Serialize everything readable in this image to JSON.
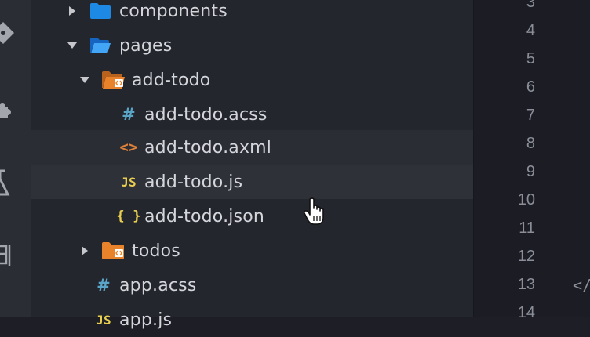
{
  "explorer": {
    "items": [
      {
        "label": "components",
        "icon": "folder-blue-icon"
      },
      {
        "label": "pages",
        "icon": "folder-open-blue-icon"
      },
      {
        "label": "add-todo",
        "icon": "folder-open-orange-icon"
      },
      {
        "label": "add-todo.acss",
        "icon": "hash-icon",
        "glyph": "#"
      },
      {
        "label": "add-todo.axml",
        "icon": "code-icon",
        "glyph": "<>"
      },
      {
        "label": "add-todo.js",
        "icon": "js-icon",
        "glyph": "JS"
      },
      {
        "label": "add-todo.json",
        "icon": "json-icon",
        "glyph": "{ }"
      },
      {
        "label": "todos",
        "icon": "folder-orange-icon"
      },
      {
        "label": "app.acss",
        "icon": "hash-icon",
        "glyph": "#"
      },
      {
        "label": "app.js",
        "icon": "js-icon",
        "glyph": "JS"
      }
    ]
  },
  "editor": {
    "line_numbers": [
      "3",
      "4",
      "5",
      "6",
      "7",
      "8",
      "9",
      "10",
      "11",
      "12",
      "13",
      "14"
    ],
    "code_fragment": "</"
  },
  "colors": {
    "folder_blue": "#1e88e5",
    "folder_orange": "#e8832b",
    "hash": "#5aa4c8",
    "js": "#e8cf50"
  }
}
